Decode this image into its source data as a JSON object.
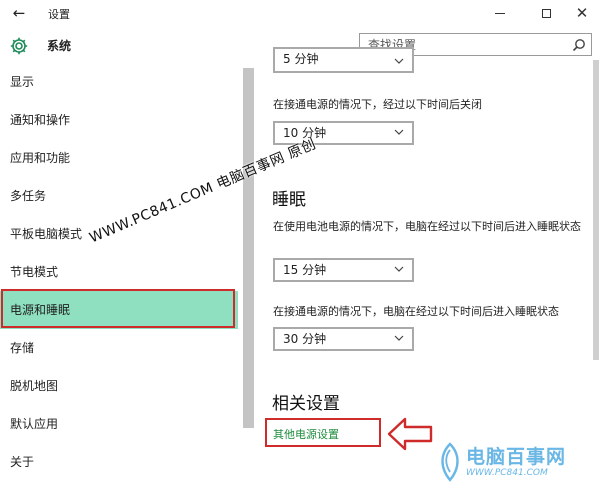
{
  "window": {
    "title": "设置",
    "back_icon": "back-arrow-icon",
    "minimize_icon": "minimize-icon",
    "maximize_icon": "maximize-icon",
    "close_icon": "close-icon"
  },
  "header": {
    "icon": "gear-icon",
    "title": "系统"
  },
  "search": {
    "placeholder": "查找设置",
    "value": "",
    "icon": "search-icon"
  },
  "sidebar": {
    "items": [
      {
        "label": "显示",
        "selected": false
      },
      {
        "label": "通知和操作",
        "selected": false
      },
      {
        "label": "应用和功能",
        "selected": false
      },
      {
        "label": "多任务",
        "selected": false
      },
      {
        "label": "平板电脑模式",
        "selected": false
      },
      {
        "label": "节电模式",
        "selected": false
      },
      {
        "label": "电源和睡眠",
        "selected": true
      },
      {
        "label": "存储",
        "selected": false
      },
      {
        "label": "脱机地图",
        "selected": false
      },
      {
        "label": "默认应用",
        "selected": false
      },
      {
        "label": "关于",
        "selected": false
      }
    ]
  },
  "screen_section": {
    "top_dropdown_value": "5 分钟",
    "plugged_label": "在接通电源的情况下，经过以下时间后关闭",
    "plugged_value": "10 分钟"
  },
  "sleep_section": {
    "heading": "睡眠",
    "battery_label": "在使用电池电源的情况下，电脑在经过以下时间后进入睡眠状态",
    "battery_value": "15 分钟",
    "plugged_label": "在接通电源的情况下，电脑在经过以下时间后进入睡眠状态",
    "plugged_value": "30 分钟"
  },
  "related": {
    "heading": "相关设置",
    "link": "其他电源设置"
  },
  "overlay": {
    "watermark": "WWW.PC841.COM 电脑百事网 原创",
    "logo_text": "电脑百事网",
    "logo_url": "WWW.PC841.COM"
  },
  "colors": {
    "selected_bg": "#8fe0c0",
    "highlight_red": "#d02b2b",
    "link_green": "#1e8c3c",
    "logo_blue": "#6ab7e6"
  }
}
